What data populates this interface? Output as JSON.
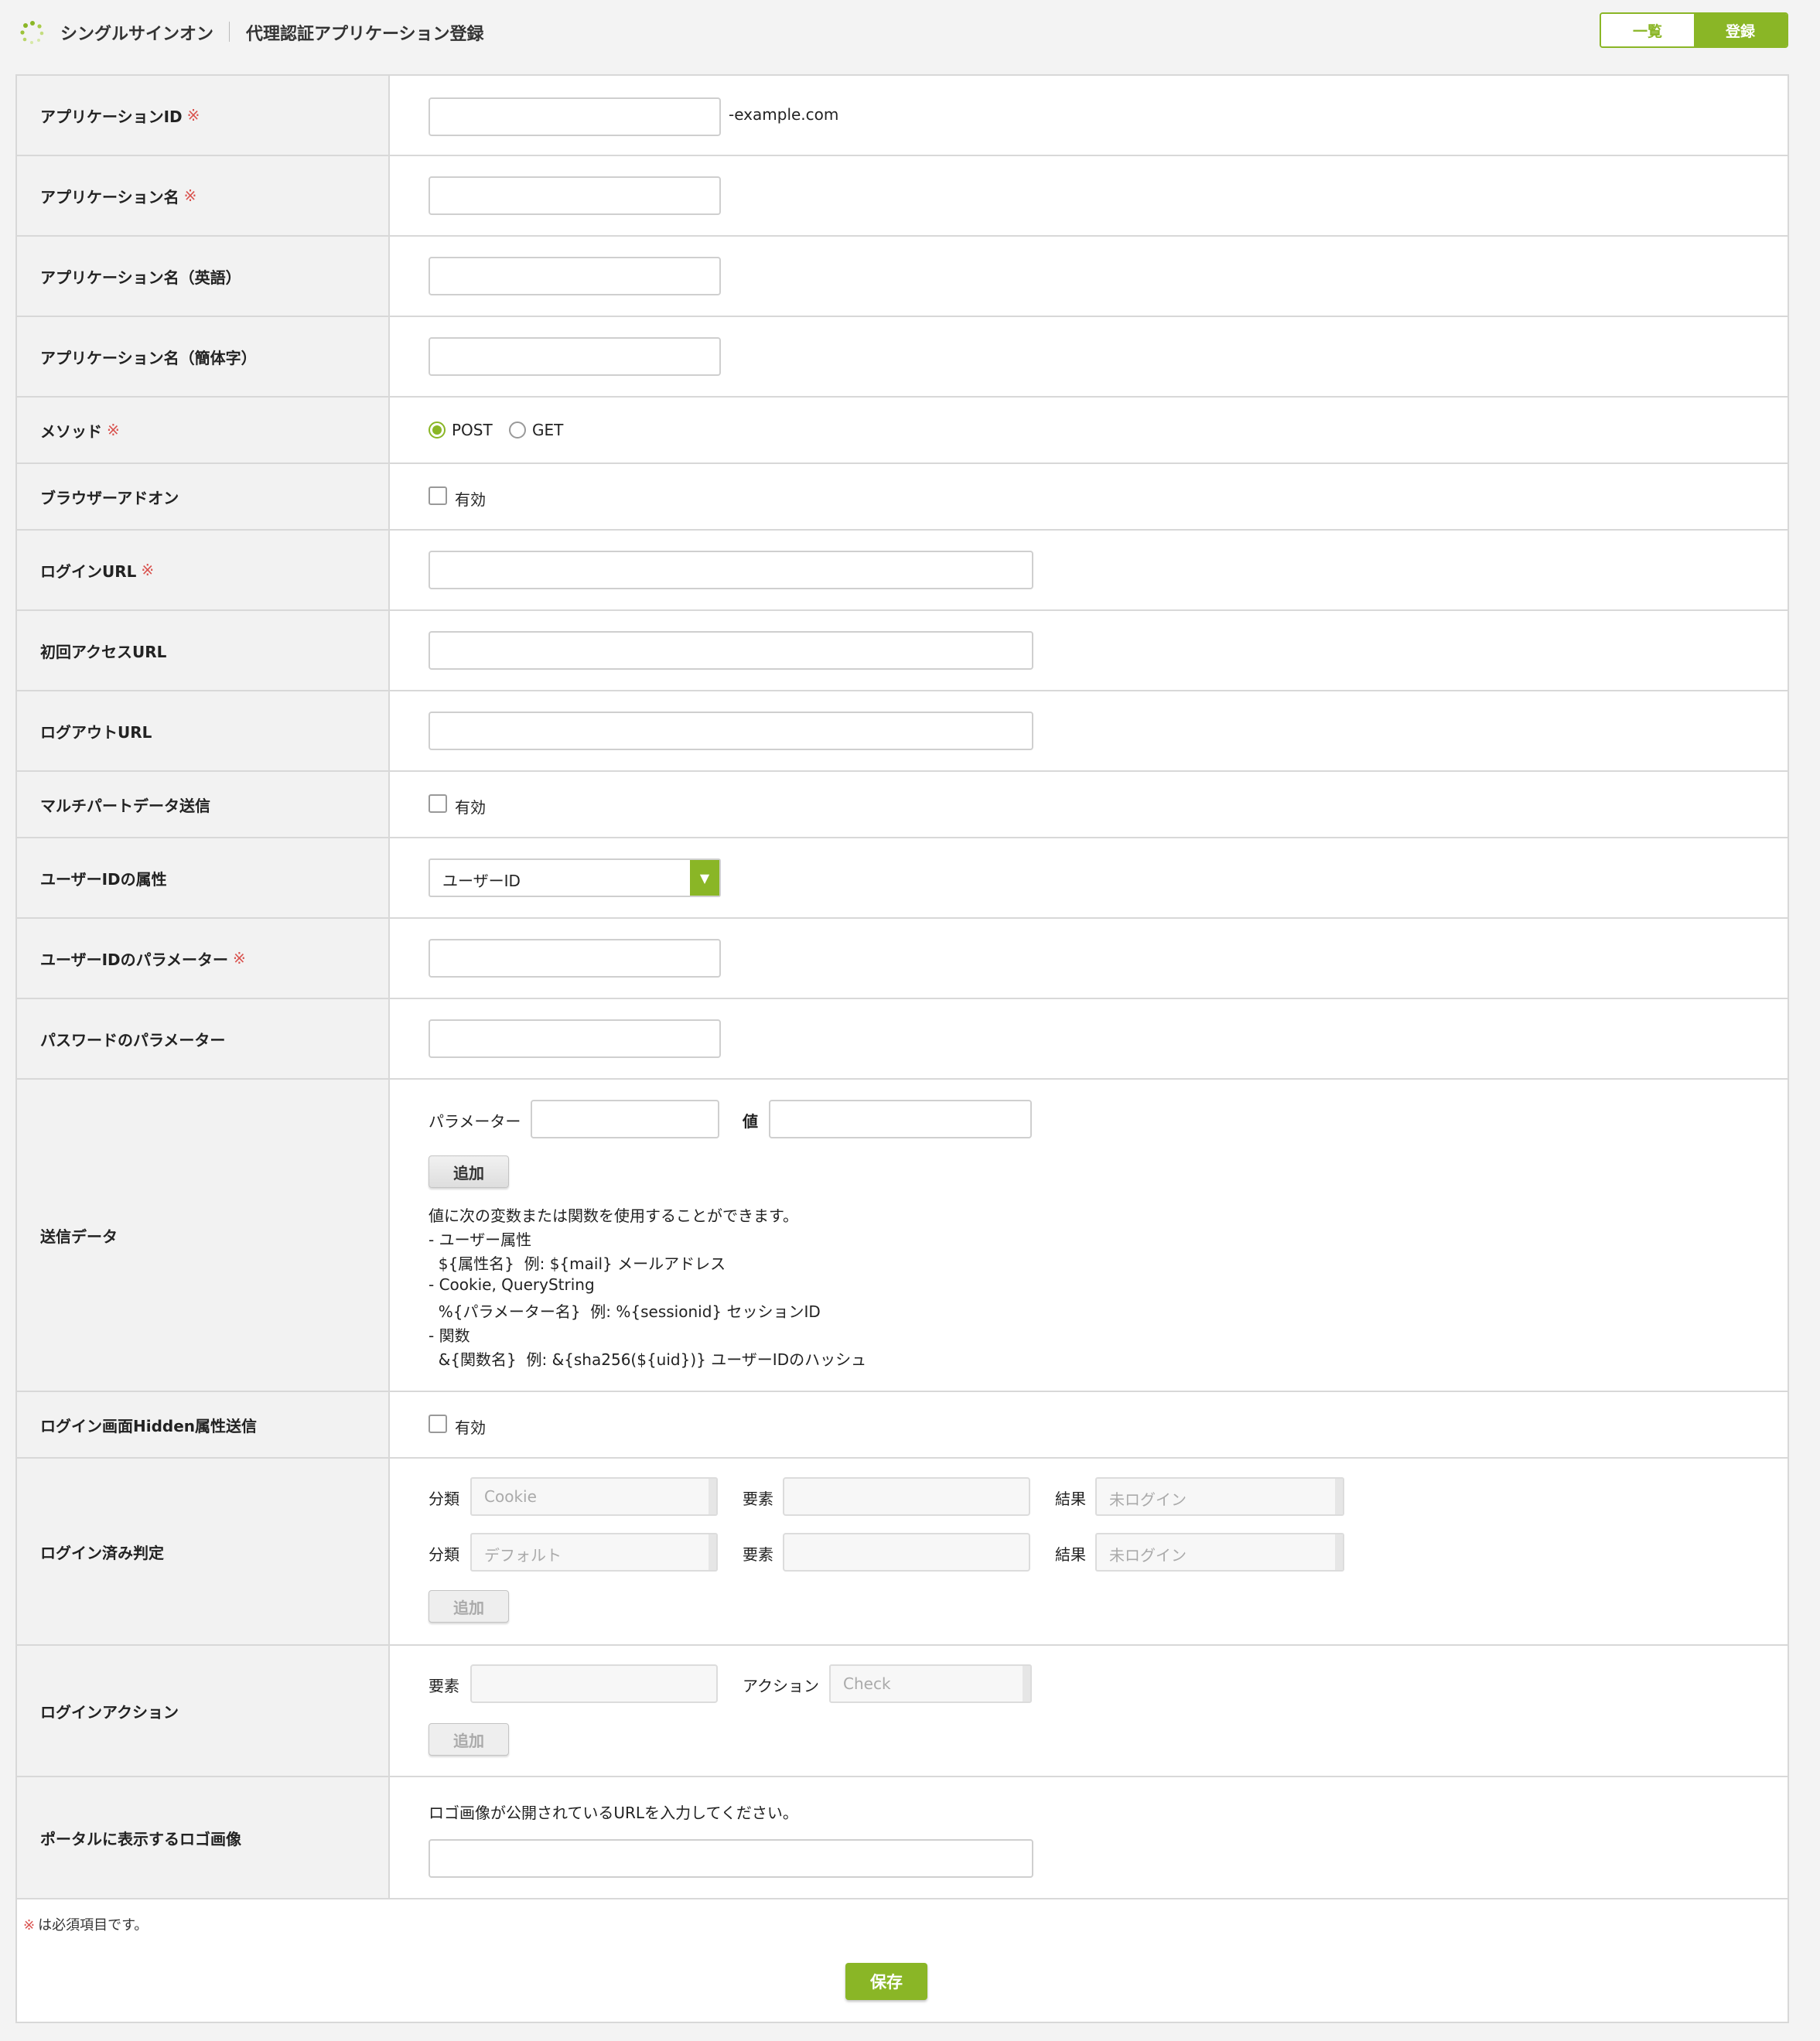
{
  "header": {
    "title": "シングルサインオン",
    "page": "代理認証アプリケーション登録",
    "list_button": "一覧",
    "register_button": "登録"
  },
  "required_mark": "※",
  "fields": {
    "app_id": {
      "label": "アプリケーションID",
      "suffix": "-example.com",
      "value": ""
    },
    "app_name": {
      "label": "アプリケーション名",
      "value": ""
    },
    "app_name_en": {
      "label": "アプリケーション名（英語）",
      "value": ""
    },
    "app_name_zh": {
      "label": "アプリケーション名（簡体字）",
      "value": ""
    },
    "method": {
      "label": "メソッド",
      "options": [
        "POST",
        "GET"
      ],
      "selected": "POST"
    },
    "browser_addon": {
      "label": "ブラウザーアドオン",
      "checkbox_label": "有効",
      "checked": false
    },
    "login_url": {
      "label": "ログインURL",
      "value": ""
    },
    "first_access_url": {
      "label": "初回アクセスURL",
      "value": ""
    },
    "logout_url": {
      "label": "ログアウトURL",
      "value": ""
    },
    "multipart": {
      "label": "マルチパートデータ送信",
      "checkbox_label": "有効",
      "checked": false
    },
    "user_id_attr": {
      "label": "ユーザーIDの属性",
      "selected": "ユーザーID"
    },
    "user_id_param": {
      "label": "ユーザーIDのパラメーター",
      "value": ""
    },
    "password_param": {
      "label": "パスワードのパラメーター",
      "value": ""
    },
    "send_data": {
      "label": "送信データ",
      "param_label": "パラメーター",
      "value_label": "値",
      "add_button": "追加",
      "help": [
        "値に次の変数または関数を使用することができます。",
        "- ユーザー属性",
        "  ${属性名}  例: ${mail} メールアドレス",
        "- Cookie, QueryString",
        "  %{パラメーター名}  例: %{sessionid} セッションID",
        "- 関数",
        "  &{関数名}  例: &{sha256(${uid})} ユーザーIDのハッシュ"
      ]
    },
    "hidden_attr": {
      "label": "ログイン画面Hidden属性送信",
      "checkbox_label": "有効",
      "checked": false
    },
    "login_check": {
      "label": "ログイン済み判定",
      "type_label": "分類",
      "element_label": "要素",
      "result_label": "結果",
      "rows": [
        {
          "type": "Cookie",
          "element": "",
          "result": "未ログイン"
        },
        {
          "type": "デフォルト",
          "element": "",
          "result": "未ログイン"
        }
      ],
      "add_button": "追加"
    },
    "login_action": {
      "label": "ログインアクション",
      "element_label": "要素",
      "action_label": "アクション",
      "action_value": "Check",
      "add_button": "追加"
    },
    "portal_logo": {
      "label": "ポータルに表示するロゴ画像",
      "help": "ロゴ画像が公開されているURLを入力してください。",
      "value": ""
    }
  },
  "footer": {
    "required_note": "は必須項目です。",
    "save_button": "保存"
  },
  "colors": {
    "accent": "#8ab626",
    "required": "#d9534f"
  }
}
